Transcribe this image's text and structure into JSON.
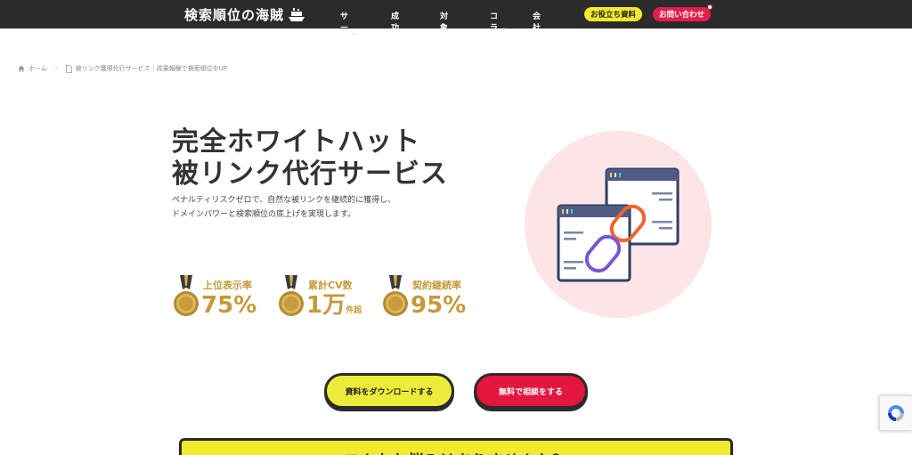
{
  "header": {
    "logo_text": "検索順位の海賊",
    "nav": [
      {
        "label": "サービス",
        "has_dropdown": true
      },
      {
        "label": "成功事例",
        "has_dropdown": false
      },
      {
        "label": "対象地域",
        "has_dropdown": false
      },
      {
        "label": "コラム",
        "has_dropdown": true
      },
      {
        "label": "会社概要",
        "has_dropdown": false
      }
    ],
    "doc_button": "お役立ち資料",
    "contact_button": "お問い合わせ"
  },
  "breadcrumb": {
    "home": "ホーム",
    "current": "被リンク獲得代行サービス｜成果報酬で検索順位をUP"
  },
  "hero": {
    "title_line1": "完全ホワイトハット",
    "title_line2": "被リンク代行サービス",
    "desc_line1": "ペナルティリスクゼロで、自然な被リンクを継続的に獲得し、",
    "desc_line2": "ドメインパワーと検索順位の底上げを実現します。"
  },
  "stats": [
    {
      "label": "上位表示率",
      "value": "75%",
      "suffix": ""
    },
    {
      "label": "累計CV数",
      "value": "1万",
      "suffix": "件超"
    },
    {
      "label": "契約継続率",
      "value": "95%",
      "suffix": ""
    }
  ],
  "cta": {
    "download": "資料をダウンロードする",
    "consult": "無料で相談をする"
  },
  "worry_box": {
    "title": "こんなお悩みはありませんか？"
  },
  "colors": {
    "header_bg": "#2b2b2b",
    "accent_yellow": "#f2ea2c",
    "accent_red": "#e31e4b",
    "gold": "#c49a3a",
    "illust_bg": "#fde4e6"
  }
}
